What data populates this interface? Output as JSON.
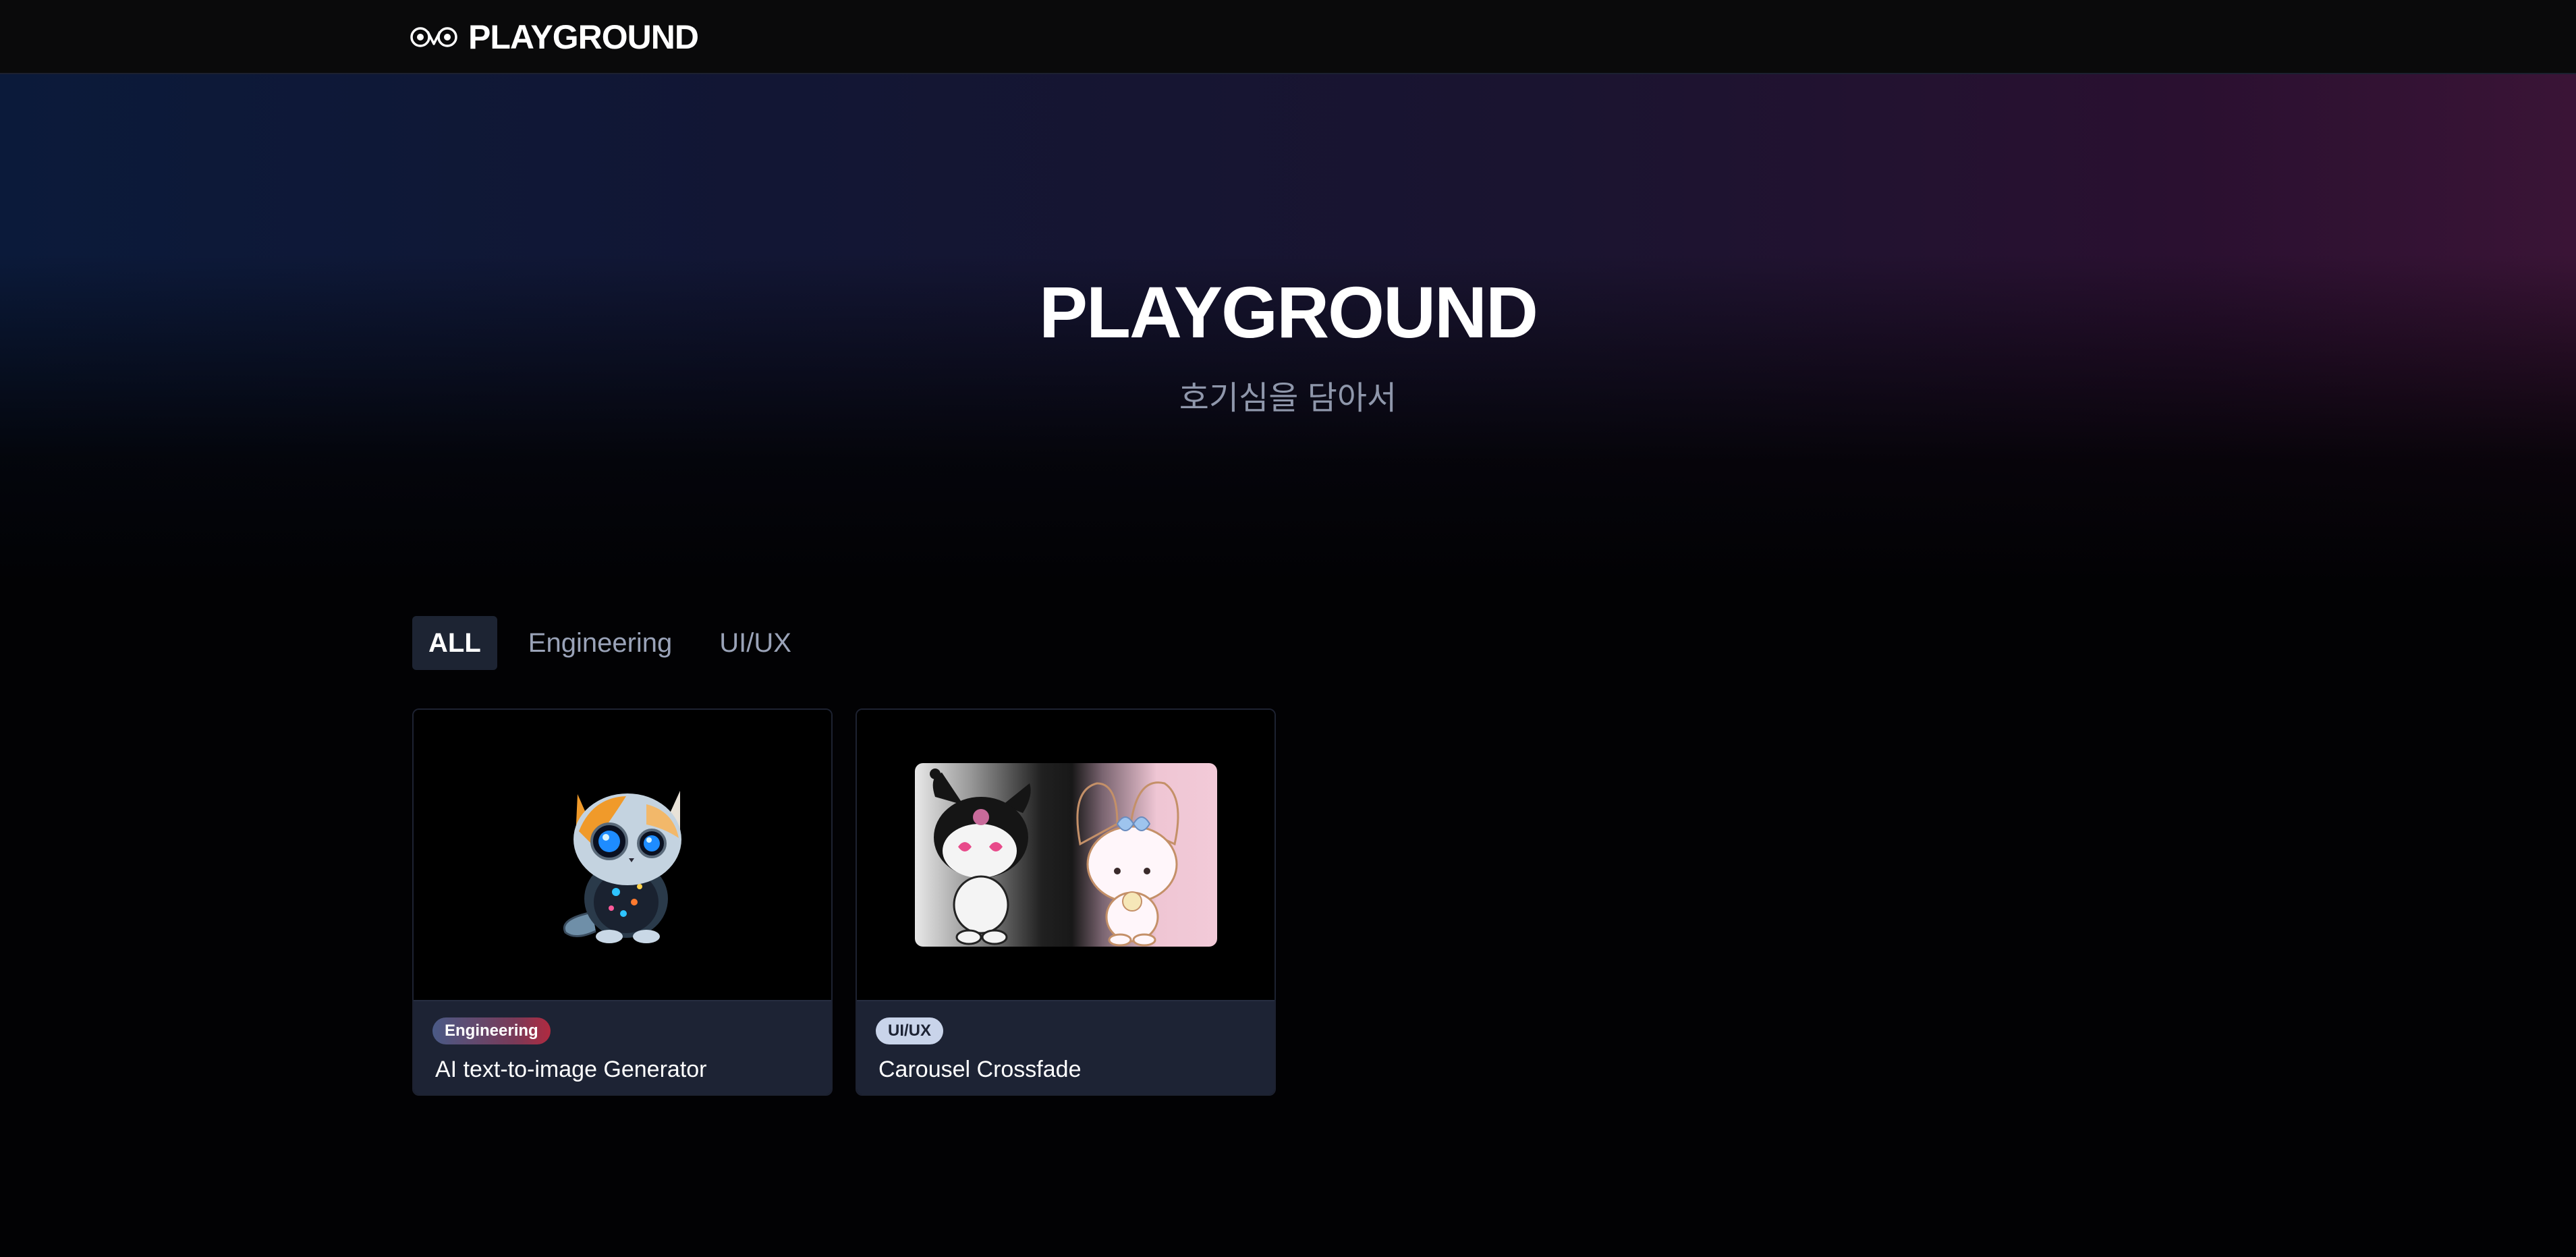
{
  "header": {
    "brand_name": "PLAYGROUND",
    "logo_icon": "eyes-logo-icon"
  },
  "hero": {
    "title": "PLAYGROUND",
    "subtitle": "호기심을 담아서",
    "gradient_colors": [
      "#0b1a3a",
      "#121634",
      "#1a1430",
      "#2a1030",
      "#3a1436"
    ]
  },
  "filters": {
    "tabs": [
      {
        "label": "ALL",
        "active": true
      },
      {
        "label": "Engineering",
        "active": false
      },
      {
        "label": "UI/UX",
        "active": false
      }
    ]
  },
  "cards": [
    {
      "category": "Engineering",
      "title": "AI text-to-image Generator",
      "image": "robot-cat-illustration"
    },
    {
      "category": "UI/UX",
      "title": "Carousel Crossfade",
      "image": "kuromi-my-melody-crossfade-illustration"
    }
  ],
  "colors": {
    "page_bg": "#020204",
    "header_bg": "#0a0a0b",
    "card_footer_bg": "#1d2334",
    "tab_active_bg": "#1d2433",
    "muted_text": "#9aa3b8"
  }
}
